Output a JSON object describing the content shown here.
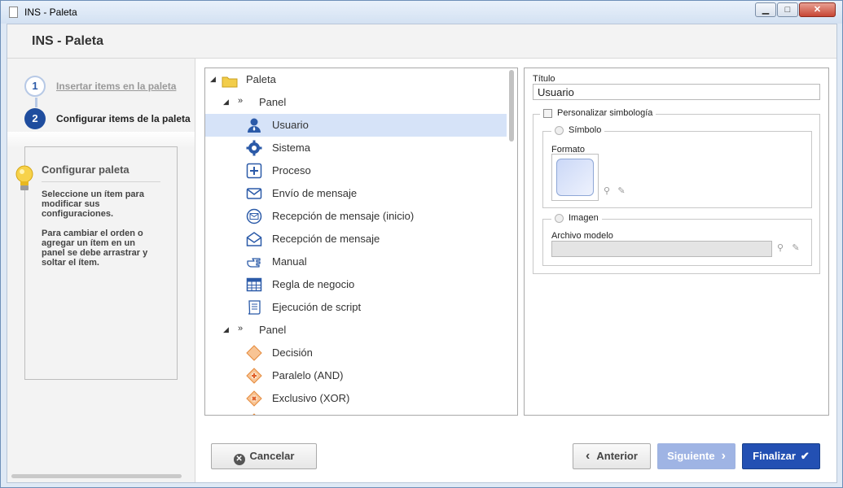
{
  "window": {
    "title": "INS - Paleta",
    "min_glyph": "▁",
    "max_glyph": "□",
    "close_glyph": "✕"
  },
  "header": {
    "title": "INS - Paleta"
  },
  "steps": [
    {
      "num": "1",
      "label": "Insertar items en la paleta"
    },
    {
      "num": "2",
      "label": "Configurar items de la paleta"
    }
  ],
  "help": {
    "title": "Configurar paleta",
    "p1": "Seleccione un ítem para modificar sus configuraciones.",
    "p2": "Para cambiar el orden o agregar un ítem en un panel se debe arrastrar y soltar el ítem."
  },
  "tree": {
    "root": "Paleta",
    "panel1": "Panel",
    "items1": [
      "Usuario",
      "Sistema",
      "Proceso",
      "Envío de mensaje",
      "Recepción de mensaje (inicio)",
      "Recepción de mensaje",
      "Manual",
      "Regla de negocio",
      "Ejecución de script"
    ],
    "panel2": "Panel",
    "items2": [
      "Decisión",
      "Paralelo (AND)",
      "Exclusivo (XOR)"
    ],
    "selected": "Usuario"
  },
  "props": {
    "titulo_label": "Título",
    "titulo_value": "Usuario",
    "personalizar_label": "Personalizar simbología",
    "simbolo_label": "Símbolo",
    "formato_label": "Formato",
    "imagen_label": "Imagen",
    "archivo_label": "Archivo modelo",
    "archivo_value": ""
  },
  "buttons": {
    "cancel": "Cancelar",
    "prev": "Anterior",
    "next": "Siguiente",
    "finish": "Finalizar"
  },
  "colors": {
    "accent": "#2350b3",
    "selected_row": "#d6e3f8",
    "icon_blue": "#2b5aa8",
    "gateway_orange": "#f5a55f"
  }
}
